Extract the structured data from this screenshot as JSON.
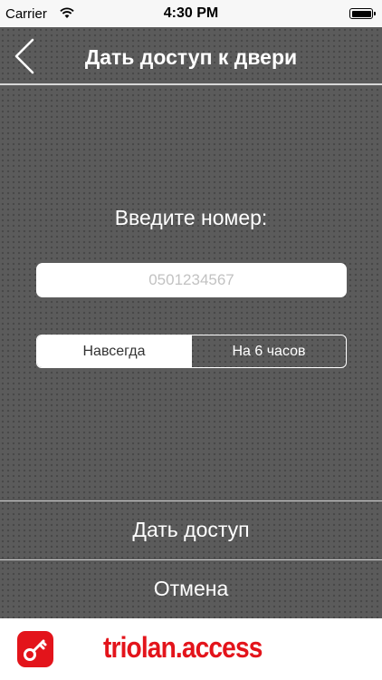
{
  "status_bar": {
    "carrier": "Carrier",
    "time": "4:30 PM",
    "wifi_icon": "wifi-icon",
    "battery_icon": "battery-icon"
  },
  "nav": {
    "title": "Дать доступ к двери",
    "back_icon": "chevron-left-icon"
  },
  "form": {
    "prompt": "Введите номер:",
    "phone_input": {
      "value": "",
      "placeholder": "0501234567"
    },
    "duration": {
      "options": [
        "Навсегда",
        "На 6 часов"
      ],
      "selected": "Навсегда"
    }
  },
  "actions": {
    "grant_label": "Дать доступ",
    "cancel_label": "Отмена"
  },
  "footer": {
    "app_icon": "key-icon",
    "brand": "triolan.access"
  },
  "colors": {
    "brand_red": "#e3141b",
    "background": "#5b5b5b",
    "text_light": "#ffffff"
  }
}
